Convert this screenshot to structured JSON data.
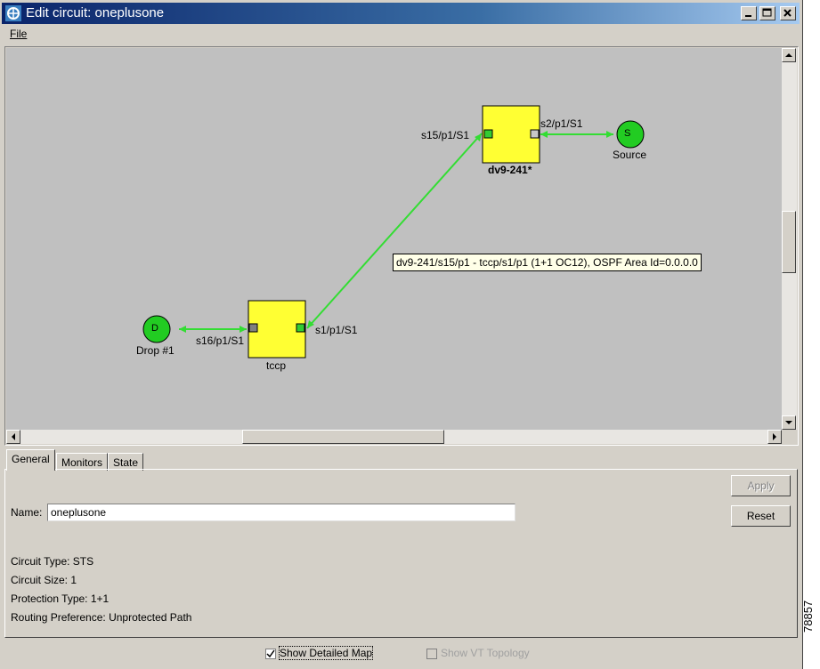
{
  "window": {
    "title": "Edit circuit: oneplusone"
  },
  "menu": {
    "file_label": "File"
  },
  "map": {
    "nodes": {
      "dv9": {
        "name": "dv9-241*",
        "left_port": "s15/p1/S1",
        "right_port": "s2/p1/S1"
      },
      "tccp": {
        "name": "tccp",
        "left_port": "s16/p1/S1",
        "right_port": "s1/p1/S1"
      }
    },
    "source": {
      "glyph": "S",
      "label": "Source"
    },
    "drop": {
      "glyph": "D",
      "label": "Drop #1"
    },
    "tooltip": "dv9-241/s15/p1 - tccp/s1/p1 (1+1 OC12), OSPF Area Id=0.0.0.0",
    "colors": {
      "node": "#ffff33",
      "link": "#33dd33",
      "endpoint": "#22cc22",
      "canvas": "#c0c0c0"
    }
  },
  "tabs": {
    "general": "General",
    "monitors": "Monitors",
    "state": "State"
  },
  "general": {
    "name_label": "Name:",
    "name_value": "oneplusone",
    "apply_label": "Apply",
    "reset_label": "Reset",
    "circuit_type": "Circuit Type:  STS",
    "circuit_size": "Circuit Size: 1",
    "protection_type": "Protection Type:  1+1",
    "routing_preference": "Routing Preference: Unprotected Path"
  },
  "footer": {
    "show_detailed_map": "Show Detailed Map",
    "show_vt_topology": "Show VT Topology"
  },
  "figure_code": "78857"
}
